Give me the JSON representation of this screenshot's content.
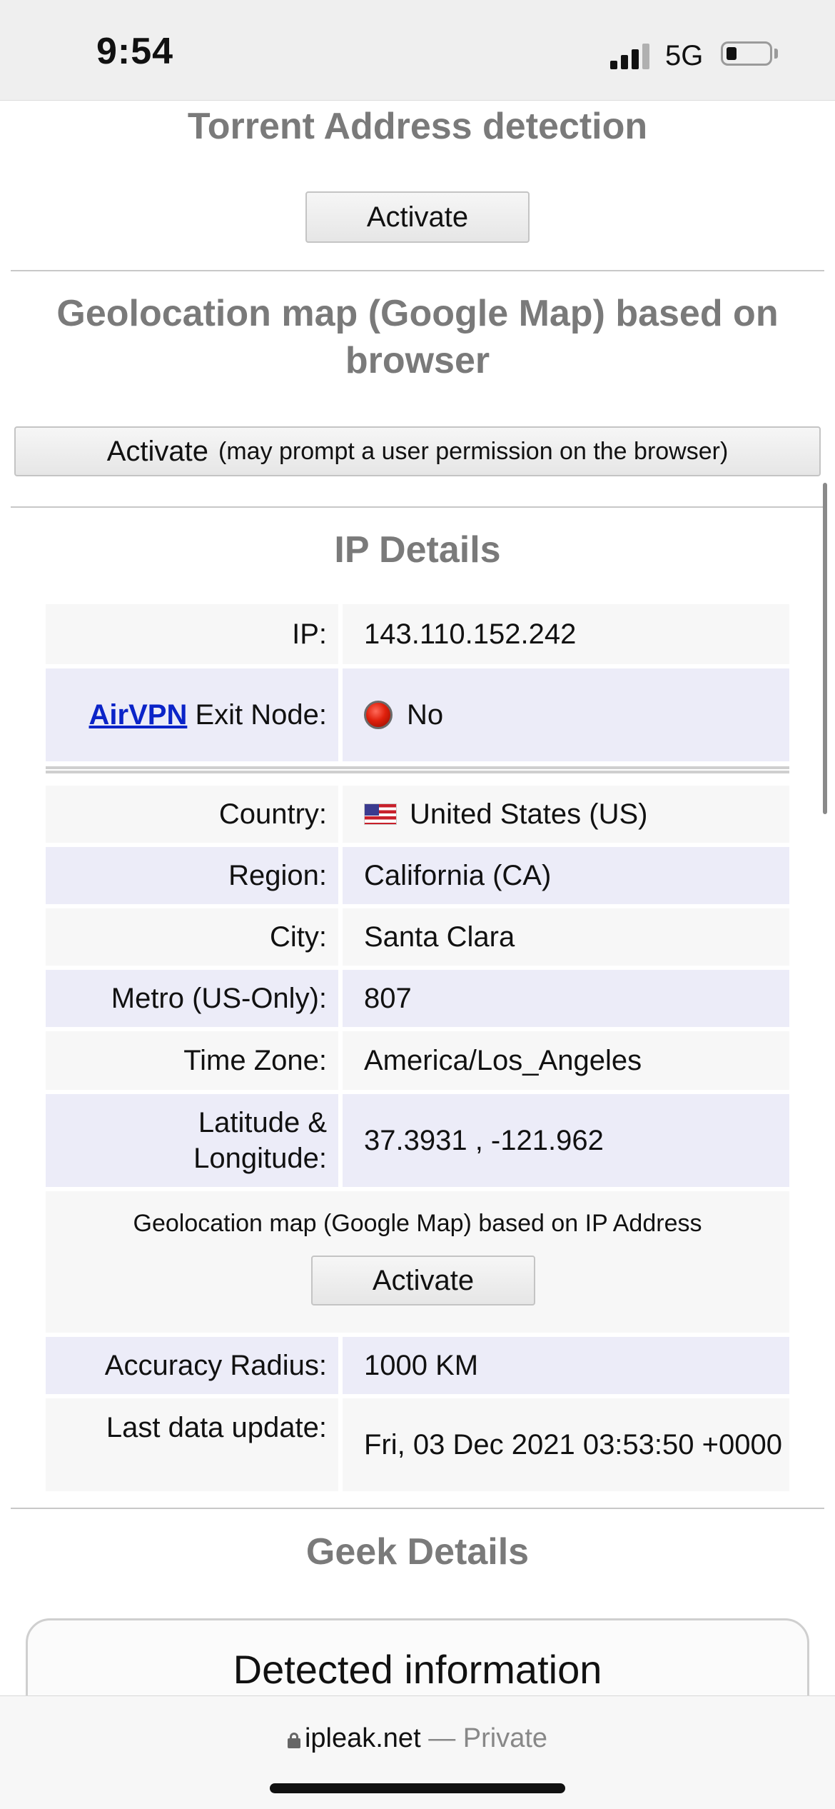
{
  "status_bar": {
    "time": "9:54",
    "network": "5G"
  },
  "torrent": {
    "title": "Torrent Address detection",
    "button": "Activate"
  },
  "browser_geo": {
    "title": "Geolocation map (Google Map) based on browser",
    "button": "Activate",
    "button_note": "(may prompt a user permission on the browser)"
  },
  "ip_details": {
    "title": "IP Details",
    "ip_label": "IP:",
    "ip_value": "143.110.152.242",
    "exit_link": "AirVPN",
    "exit_label_rest": "Exit Node:",
    "exit_value": "No",
    "rows": [
      {
        "label": "Country:",
        "value": "United States (US)"
      },
      {
        "label": "Region:",
        "value": "California (CA)"
      },
      {
        "label": "City:",
        "value": "Santa Clara"
      },
      {
        "label": "Metro (US-Only):",
        "value": "807"
      },
      {
        "label": "Time Zone:",
        "value": "America/Los_Angeles"
      },
      {
        "label": "Latitude & Longitude:",
        "value": "37.3931 , -121.962"
      }
    ],
    "ip_geo_label": "Geolocation map (Google Map) based on IP Address",
    "ip_geo_button": "Activate",
    "accuracy_label": "Accuracy Radius:",
    "accuracy_value": "1000 KM",
    "updated_label": "Last data update:",
    "updated_value": "Fri, 03 Dec 2021 03:53:50 +0000"
  },
  "geek": {
    "title": "Geek Details",
    "detected_title": "Detected information"
  },
  "address_bar": {
    "domain": "ipleak.net",
    "separator": "—",
    "mode": "Private"
  }
}
